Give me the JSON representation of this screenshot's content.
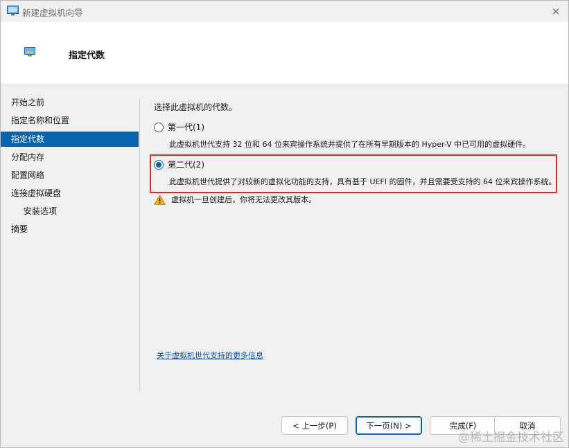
{
  "window": {
    "title": "新建虚拟机向导",
    "close_glyph": "✕"
  },
  "header": {
    "title": "指定代数",
    "icon": "monitor-icon"
  },
  "nav": {
    "items": [
      {
        "label": "开始之前",
        "active": false,
        "sub": false
      },
      {
        "label": "指定名称和位置",
        "active": false,
        "sub": false
      },
      {
        "label": "指定代数",
        "active": true,
        "sub": false
      },
      {
        "label": "分配内存",
        "active": false,
        "sub": false
      },
      {
        "label": "配置网络",
        "active": false,
        "sub": false
      },
      {
        "label": "连接虚拟硬盘",
        "active": false,
        "sub": false
      },
      {
        "label": "安装选项",
        "active": false,
        "sub": true
      },
      {
        "label": "摘要",
        "active": false,
        "sub": false
      }
    ]
  },
  "main": {
    "prompt": "选择此虚拟机的代数。",
    "gen1": {
      "label": "第一代(1)",
      "checked": false,
      "desc": "此虚拟机世代支持 32 位和 64 位来宾操作系统并提供了在所有早期版本的 Hyper-V 中已可用的虚拟硬件。"
    },
    "gen2": {
      "label": "第二代(2)",
      "checked": true,
      "desc": "此虚拟机世代提供了对较新的虚拟化功能的支持，具有基于 UEFI 的固件，并且需要受支持的 64 位来宾操作系统。"
    },
    "warning": "虚拟机一旦创建后，你将无法更改其版本。",
    "more_link": "关于虚拟机世代支持的更多信息"
  },
  "footer": {
    "prev_label": "< 上一步(P)",
    "next_label": "下一页(N) >",
    "finish_label": "完成(F)",
    "cancel_label": "取消"
  },
  "watermark": "@稀土掘金技术社区",
  "colors": {
    "accent": "#0a64ad",
    "highlight": "#d32f2f",
    "link": "#0a4fa6"
  }
}
